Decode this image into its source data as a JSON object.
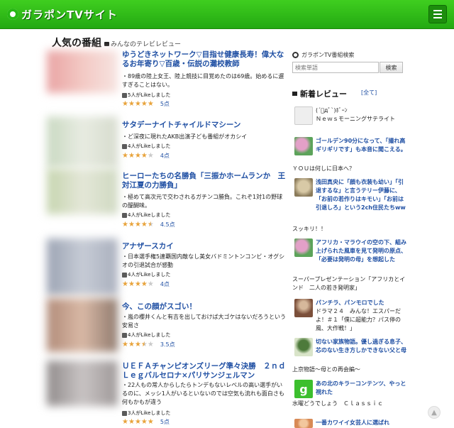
{
  "header": {
    "logo_text": "ガラポンTVサイト"
  },
  "page": {
    "title": "人気の番組",
    "subtitle": "みんなのテレビレビュー"
  },
  "programs": [
    {
      "title": "ゆうどきネットワーク▽目指せ健康長寿！偉大なるお年寄り▽百歳・伝説の灘校教師",
      "desc": "・89歳の陸上女王、陸上競技に目覚めたのは69歳。始めるに遅すぎることはない。",
      "likes": "5人がLikeしました",
      "rating": 5,
      "score": "5点"
    },
    {
      "title": "サタデーナイトチャイルドマシーン",
      "desc": "・ど深夜に現れたAKB出演子ども番組がオカシイ",
      "likes": "4人がLikeしました",
      "rating": 4,
      "score": "4点"
    },
    {
      "title": "ヒーローたちの名勝負「三振かホームランか　王対江夏の力勝負」",
      "desc": "・極めて高次元で交わされるガチンコ勝負。これぞ1対1の野球の醍醐味。",
      "likes": "4人がLikeしました",
      "rating": 4.5,
      "score": "4.5点"
    },
    {
      "title": "アナザースカイ",
      "desc": "・日本選手権5連覇国内敵なし美女バドミントンコンビ・オグシオの引退試合が感動",
      "likes": "4人がLikeしました",
      "rating": 4,
      "score": "4点"
    },
    {
      "title": "今、この顔がスゴい！",
      "desc": "・嵐の櫻井くんと有吉を出しておけば大ゴケはないだろうという安易さ",
      "likes": "4人がLikeしました",
      "rating": 3.5,
      "score": "3.5点"
    },
    {
      "title": "ＵＥＦＡチャンピオンズリーグ準々決勝　２ｎｄＬｅｇバルセロナ×パリサンジェルマン",
      "desc": "・22人もの常人からしたらトンデもないレベルの高い選手がいるのに、メッシ1人がいるといないのでは空気も流れも面白さも何もかもが違う",
      "likes": "3人がLikeしました",
      "rating": 5,
      "score": "5点"
    }
  ],
  "sidebar": {
    "search_label": "ガラポンTV番組検索",
    "search_placeholder": "検索単語",
    "search_button": "検索",
    "new_reviews_title": "新着レビュー",
    "all_link": "[全て]",
    "reviews": [
      {
        "icon": "tv-icon",
        "title": "(´ﾟдﾟ`)ﾎﾞｰﾝ",
        "text": "Ｎｅｗｓモーニングサテライト"
      },
      {
        "icon": "flower-icon",
        "title": "ゴールデン90分になって、「撮れ高ギリギリです」も本音に聞こえる。",
        "text": "ＹＯＵは何しに日本へ？"
      },
      {
        "icon": "face-icon",
        "title": "浅田真央に「顔も衣装も幼い」「引退するな」と言うテリー伊藤に、「お前の若作りはキモい」「お前は引退しろ」という2ch住民たちww",
        "text": "スッキリ！！"
      },
      {
        "icon": "flower-icon",
        "title": "アフリカ・マラウイの空の下、組み上げられた風車を見て発明の原点、「必要は発明の母」を想起した",
        "text": "スーパープレゼンテーション「アフリカとインド　二人の若き発明家」"
      },
      {
        "icon": "person-icon",
        "title": "パンチラ、パンモロでした",
        "text": "ドラマ２４　みんな！エスパーだよ！＃１「僕に超能力？パス停の風、大作戦！」"
      },
      {
        "icon": "tree-icon",
        "title": "切ない家族物語。優し過ぎる息子、芯のない生き方しかできない父と母",
        "text": "上京物語～母との再会編～"
      },
      {
        "icon": "g-icon",
        "title": "あの北のキラーコンテンツ、やっと視れた",
        "text": "水曜どうでしょう　Ｃｌａｓｓｉｃ"
      },
      {
        "icon": "hand-icon",
        "title": "一番カワイイ女芸人に選ばれ",
        "text": ""
      }
    ]
  }
}
